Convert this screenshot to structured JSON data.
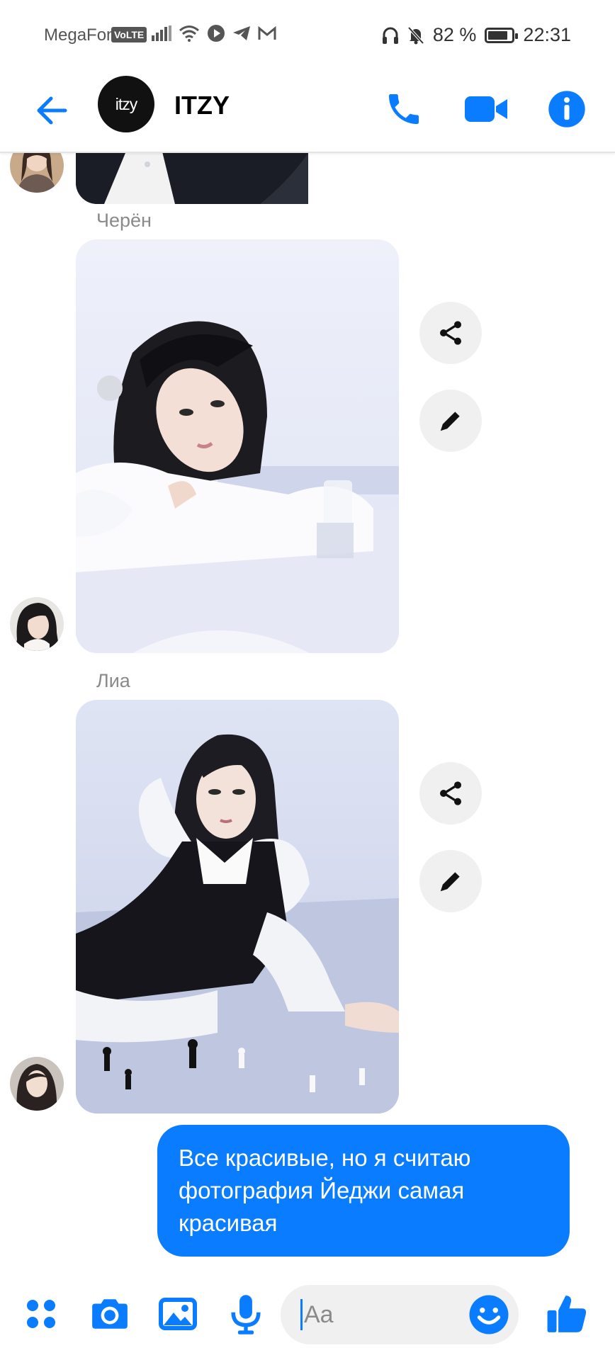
{
  "status_bar": {
    "carrier": "MegaFon",
    "volte": "VoLTE",
    "battery_text": "82 %",
    "battery_level": 0.82,
    "time": "22:31"
  },
  "header": {
    "group_avatar_text": "itzy",
    "group_name": "ITZY"
  },
  "messages": [
    {
      "type": "photo",
      "sender": "Черён"
    },
    {
      "type": "photo",
      "sender": "Лиа"
    },
    {
      "type": "text",
      "outgoing": true,
      "text": "Все красивые, но я считаю фотография Йеджи самая красивая"
    }
  ],
  "composer": {
    "placeholder": "Aa"
  },
  "colors": {
    "accent": "#0a7cff",
    "bubble_text": "#ffffff",
    "sender_label": "#8a8a8a",
    "action_button_bg": "#f0f0f0"
  },
  "icons": [
    "arrow-left-icon",
    "phone-icon",
    "video-camera-icon",
    "info-icon",
    "share-icon",
    "pencil-icon",
    "apps-grid-icon",
    "camera-icon",
    "image-icon",
    "microphone-icon",
    "emoji-icon",
    "thumbs-up-icon"
  ]
}
